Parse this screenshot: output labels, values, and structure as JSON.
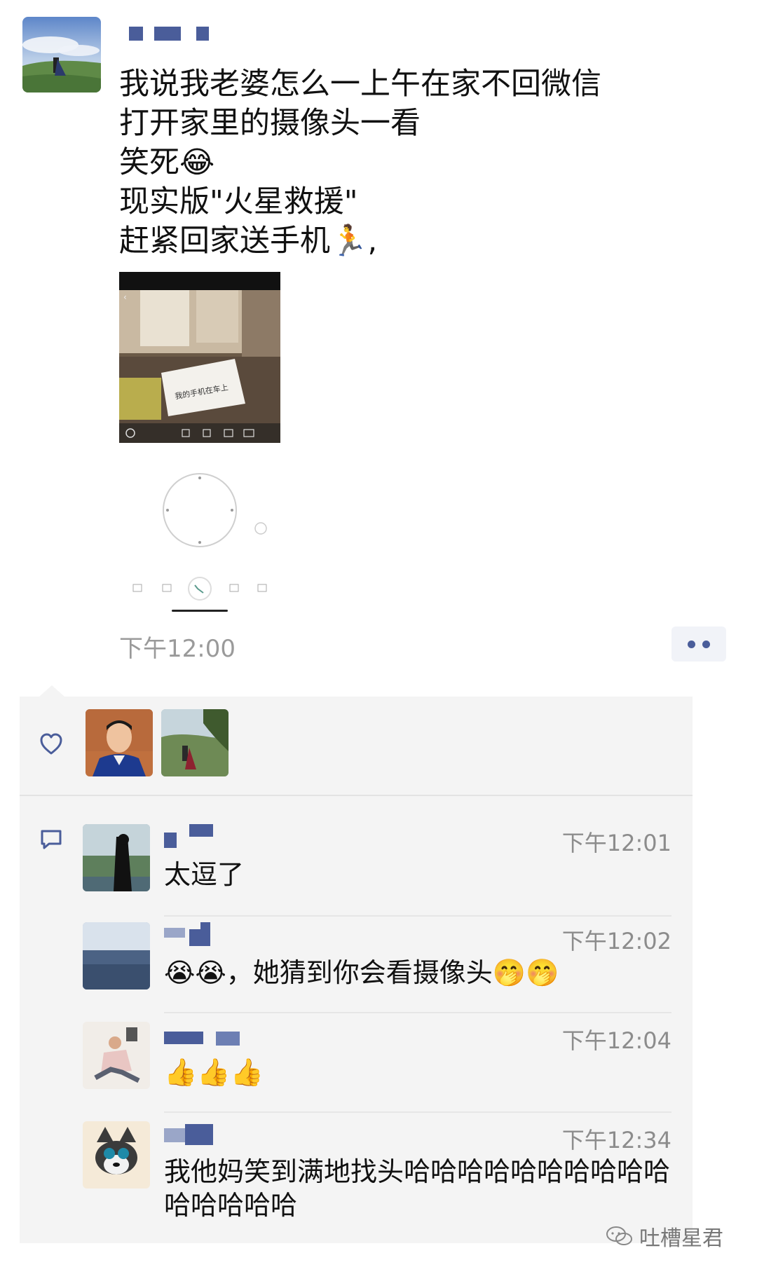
{
  "post": {
    "lines": [
      "我说我老婆怎么一上午在家不回微信",
      "打开家里的摄像头一看",
      "笑死😂",
      "现实版\"火星救援\"",
      "赶紧回家送手机🏃,"
    ],
    "time": "下午12:00",
    "image_note": "我的手机在车上"
  },
  "comments": [
    {
      "time": "下午12:01",
      "text": "太逗了"
    },
    {
      "time": "下午12:02",
      "text": "😭😭，她猜到你会看摄像头🤭🤭"
    },
    {
      "time": "下午12:04",
      "text": "👍👍👍"
    },
    {
      "time": "下午12:34",
      "text": "我他妈笑到满地找头哈哈哈哈哈哈哈哈哈哈哈哈哈哈哈"
    }
  ],
  "watermark": {
    "text": "吐槽星君"
  },
  "colors": {
    "name_blue": "#4a5d9a",
    "time_gray": "#9a9a9a",
    "panel_bg": "#f4f4f4"
  }
}
